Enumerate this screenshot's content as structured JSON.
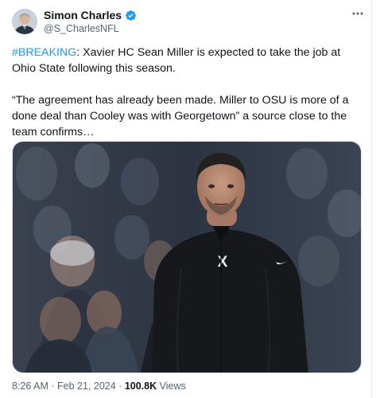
{
  "author": {
    "display_name": "Simon Charles",
    "handle": "@S_CharlesNFL",
    "verified_icon": "verified-badge-icon"
  },
  "tweet": {
    "hashtag": "#BREAKING",
    "line1_rest": ": Xavier HC Sean Miller is expected to take the job at Ohio State following this season.",
    "quote": "“The agreement has already been made. Miller to OSU is more of a done deal than Cooley was with Georgetown” a source close to the team confirms…"
  },
  "media": {
    "jersey_logo": "X"
  },
  "meta": {
    "time": "8:26 AM",
    "separator": "·",
    "date": "Feb 21, 2024",
    "views_count": "100.8K",
    "views_label": "Views"
  },
  "colors": {
    "link": "#1d9bf0",
    "verified": "#1d9bf0",
    "text": "#0f1419",
    "muted": "#536471"
  }
}
